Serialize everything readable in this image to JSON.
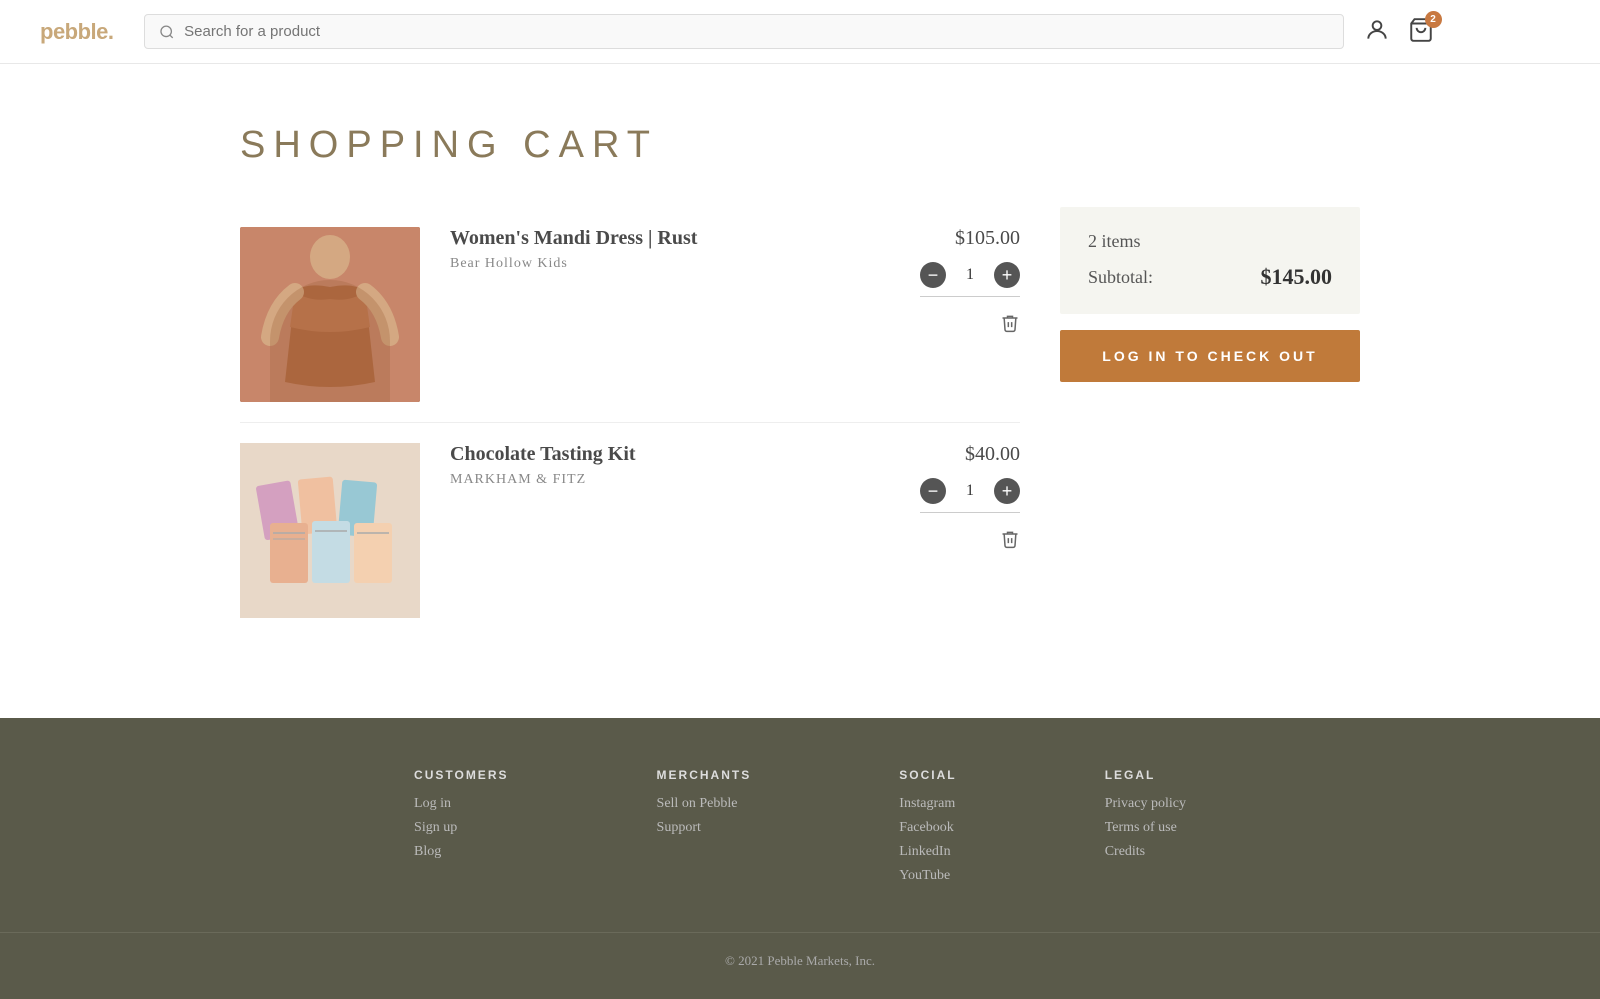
{
  "header": {
    "logo_text": "pebble.",
    "search_placeholder": "Search for a product",
    "cart_badge": "2"
  },
  "page": {
    "title": "SHOPPING CART"
  },
  "cart": {
    "items": [
      {
        "id": "dress",
        "name": "Women's Mandi Dress | Rust",
        "brand": "Bear Hollow Kids",
        "price": "$105.00",
        "quantity": 1,
        "image_type": "dress"
      },
      {
        "id": "chocolate",
        "name": "Chocolate Tasting Kit",
        "brand": "MARKHAM & FITZ",
        "price": "$40.00",
        "quantity": 1,
        "image_type": "choc"
      }
    ],
    "summary": {
      "item_count": "2 items",
      "subtotal_label": "Subtotal:",
      "subtotal_amount": "$145.00",
      "checkout_label": "LOG IN TO CHECK OUT"
    }
  },
  "footer": {
    "columns": [
      {
        "heading": "CUSTOMERS",
        "links": [
          "Log in",
          "Sign up",
          "Blog"
        ]
      },
      {
        "heading": "MERCHANTS",
        "links": [
          "Sell on Pebble",
          "Support"
        ]
      },
      {
        "heading": "SOCIAL",
        "links": [
          "Instagram",
          "Facebook",
          "LinkedIn",
          "YouTube"
        ]
      },
      {
        "heading": "LEGAL",
        "links": [
          "Privacy policy",
          "Terms of use",
          "Credits"
        ]
      }
    ],
    "copyright": "© 2021 Pebble Markets, Inc."
  }
}
